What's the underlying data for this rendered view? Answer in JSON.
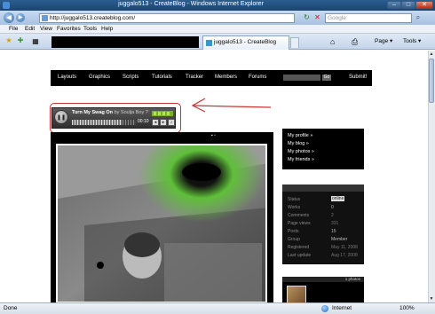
{
  "window": {
    "title": "juggalo513 - CreateBlog - Windows Internet Explorer",
    "min": "–",
    "max": "□",
    "close": "✕"
  },
  "address": {
    "url": "http://juggalo513.createblog.com/",
    "search_placeholder": "Google"
  },
  "nav_buttons": {
    "back": "◀",
    "forward": "▶",
    "refresh": "↻",
    "stop": "✕",
    "go": "⌕"
  },
  "menu": [
    "File",
    "Edit",
    "View",
    "Favorites",
    "Tools",
    "Help"
  ],
  "tabs": {
    "active": "juggalo513 - CreateBlog"
  },
  "toolbar": {
    "page": "Page ▾",
    "tools": "Tools ▾",
    "home": "⌂",
    "print": "⎙"
  },
  "site_nav": {
    "items": [
      "Layouts",
      "Graphics",
      "Scripts",
      "Tutorials",
      "Tracker",
      "Members",
      "Forums"
    ],
    "go": "Go",
    "submit": "Submit!"
  },
  "player": {
    "song_title": "Turn My Swag On",
    "artist_prefix": "by",
    "artist": "Soulja Boy ?",
    "time": "00:10",
    "play_icon": "❚❚",
    "progress": 0.78
  },
  "sidebar_links": [
    "My profile »",
    "My blog »",
    "My photos »",
    "My friends »"
  ],
  "profile_stats": {
    "rows": [
      {
        "label": "Status",
        "value": "online"
      },
      {
        "label": "Works",
        "value": "0"
      },
      {
        "label": "Comments",
        "value": "2"
      },
      {
        "label": "Page views",
        "value": "331"
      },
      {
        "label": "Posts",
        "value": "15"
      },
      {
        "label": "Group",
        "value": "Member"
      },
      {
        "label": "Registered",
        "value": "May 11, 2008"
      },
      {
        "label": "Last update",
        "value": "Aug 17, 2008"
      }
    ]
  },
  "photos_header": "1 photos",
  "status": {
    "left": "Done",
    "zone": "Internet",
    "zoom": "100%"
  },
  "colors": {
    "annotation_red": "#cc3333",
    "eq_green": "#7ab321"
  }
}
